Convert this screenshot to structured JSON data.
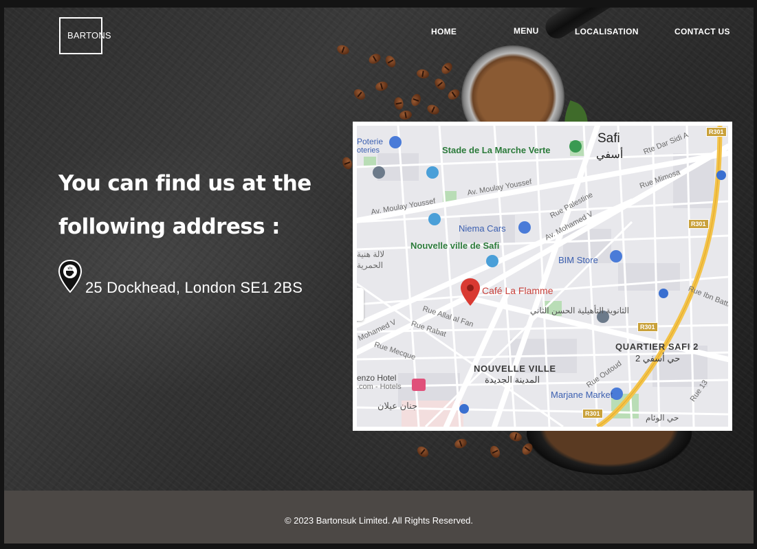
{
  "brand": {
    "name": "BARTONS"
  },
  "nav": {
    "items": [
      {
        "label": "HOME"
      },
      {
        "label": "MENU"
      },
      {
        "label": "LOCALISATION"
      },
      {
        "label": "CONTACT US"
      }
    ]
  },
  "hero": {
    "headline_line1": "You can find us at the",
    "headline_line2": "following address :",
    "address": "25 Dockhead, London SE1 2BS"
  },
  "map": {
    "labels": {
      "city": "Safi",
      "city_ar": "أسفي",
      "stadium": "Stade de La Marche Verte",
      "poterie": "Poterie",
      "poterie2": "oteries",
      "moulay_youssef_1": "Av. Moulay Youssef",
      "moulay_youssef_2": "Av. Moulay Youssef",
      "mohamed_v": "Av. Mohamed V",
      "rue_mimosa": "Rue Mimosa",
      "rue_palestine": "Rue Palestine",
      "rte_dar_sidi": "Rte Dar Sidi A",
      "niema_cars": "Niema Cars",
      "nouvelle_ville_safi": "Nouvelle ville de Safi",
      "bim_store": "BIM Store",
      "cafe": "Café La Flamme",
      "lycee_ar": "الثانوية التأهيلية الحسن الثاني",
      "quartier": "QUARTIER SAFI 2",
      "quartier_ar": "حي أسفي 2",
      "nouvelle_ville": "NOUVELLE VILLE",
      "nouvelle_ville_ar": "المدينة الجديدة",
      "marjane": "Marjane Market",
      "hotel": "enzo Hotel",
      "hotel_sub": ".com - Hotels",
      "jnane_ar": "جنان عيلان",
      "rue_allal": "Rue Allal al Fan",
      "rue_rabat": "Rue Rabat",
      "rue_mecque": "Rue Mecque",
      "mohamed_v_left": "Mohamed V",
      "rue_outoud": "Rue Outoud",
      "rue_ibn": "Rue Ibn Battut",
      "rue_13": "Rue 13",
      "left_ar1": "لالة هنية",
      "left_ar2": "الحمرية",
      "hay_ar": "حي الوئام"
    },
    "route_badge": "R301"
  },
  "footer": {
    "copyright": "© 2023 Bartonsuk Limited. All Rights Reserved."
  },
  "colors": {
    "footer_bg": "#4c4845",
    "pin_red": "#d93a32",
    "route_yellow": "#f3c34a"
  }
}
